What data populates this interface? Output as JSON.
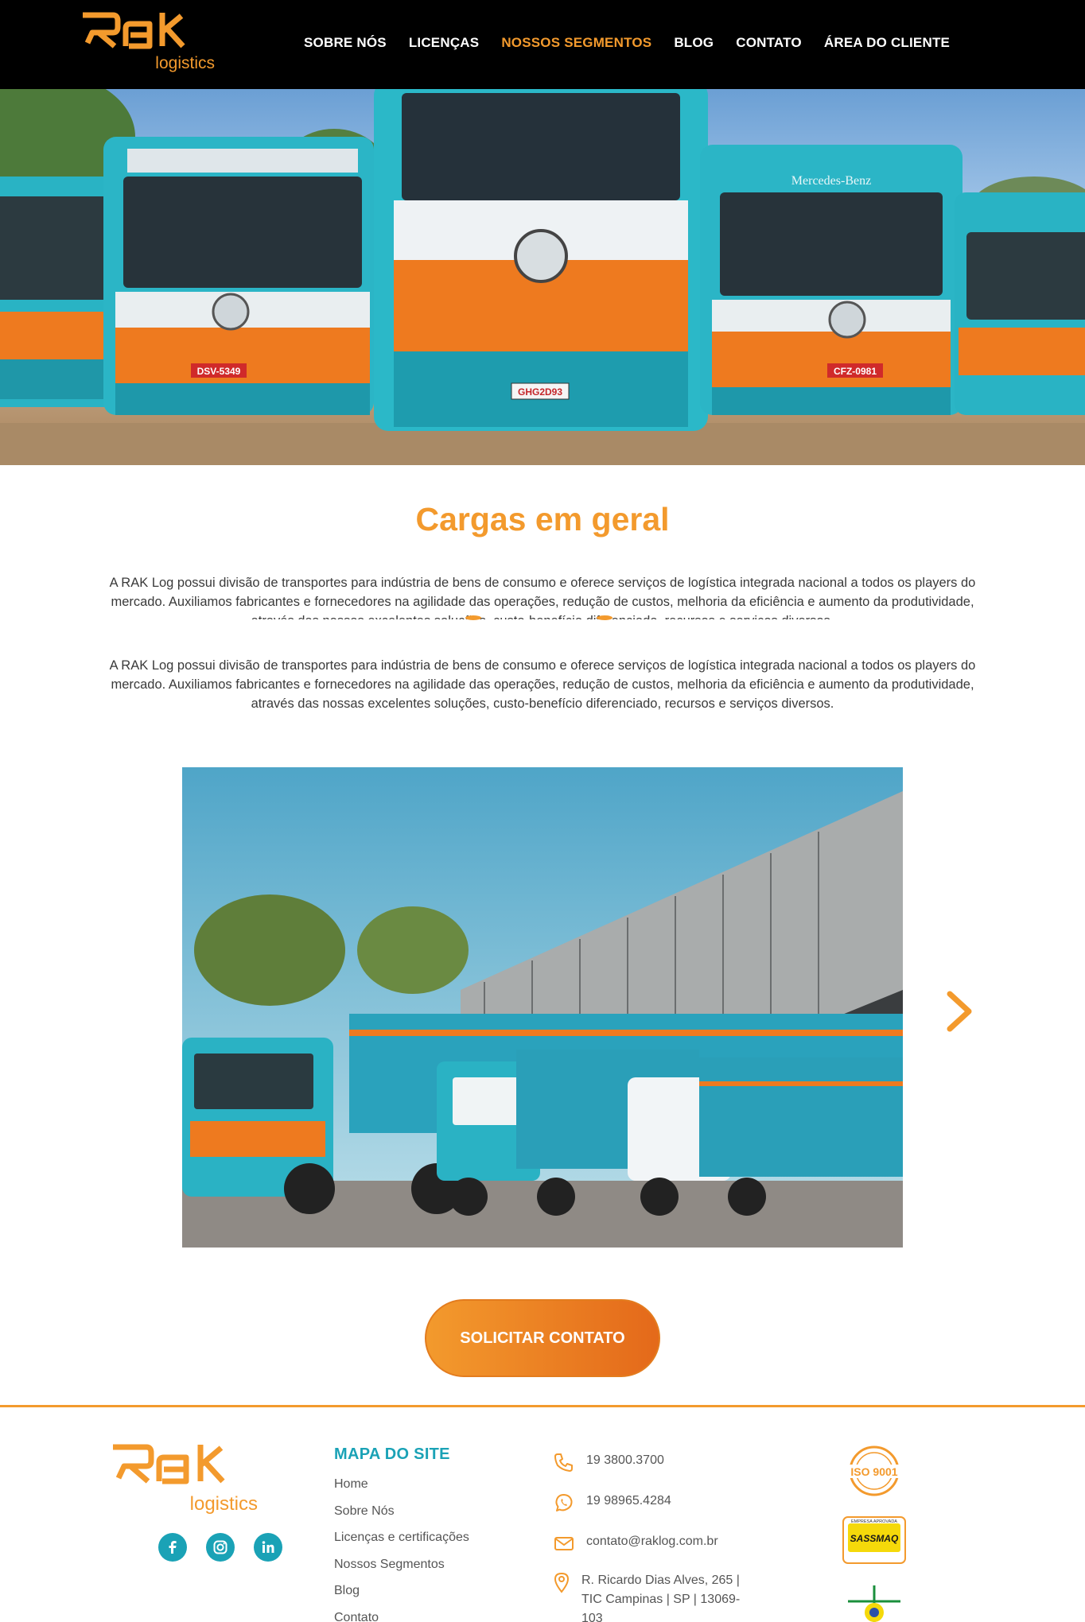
{
  "brand": {
    "logo_main": "RAK",
    "logo_sub": "logistics",
    "primary_color": "#f39a2d",
    "accent_color": "#1aa2b6"
  },
  "nav": {
    "items": [
      {
        "label": "SOBRE NÓS",
        "active": false
      },
      {
        "label": "LICENÇAS",
        "active": false
      },
      {
        "label": "NOSSOS SEGMENTOS",
        "active": true
      },
      {
        "label": "BLOG",
        "active": false
      },
      {
        "label": "CONTATO",
        "active": false
      },
      {
        "label": "ÁREA DO CLIENTE",
        "active": false
      }
    ]
  },
  "hero": {
    "truck_plates": [
      "DSV-5349",
      "GHG2D93",
      "CFZ-0981"
    ],
    "truck_brand_text": "Mercedes-Benz"
  },
  "section": {
    "title": "Cargas em geral",
    "paragraph": "A RAK Log possui divisão de transportes para indústria de bens de consumo e oferece serviços de logística integrada nacional a todos os players do mercado. Auxiliamos fabricantes e fornecedores na agilidade das operações, redução de custos, melhoria da eficiência e aumento da produtividade, através das nossas excelentes soluções, custo-benefício diferenciado, recursos e serviços diversos."
  },
  "gallery": {
    "next_icon": "chevron-right-icon"
  },
  "cta": {
    "label": "SOLICITAR CONTATO"
  },
  "footer": {
    "social": [
      "facebook-icon",
      "instagram-icon",
      "linkedin-icon"
    ],
    "sitemap_title": "MAPA DO SITE",
    "sitemap": [
      "Home",
      "Sobre Nós",
      "Licenças e certificações",
      "Nossos Segmentos",
      "Blog",
      "Contato"
    ],
    "phone": "19 3800.3700",
    "whatsapp": "19 98965.4284",
    "email": "contato@raklog.com.br",
    "address": "R. Ricardo Dias Alves, 265 | TIC Campinas | SP | 13069-103",
    "badges": {
      "iso": "ISO 9001",
      "sassmaq": "SASSMAQ",
      "sassmaq_top": "EMPRESA APROVADA"
    }
  }
}
